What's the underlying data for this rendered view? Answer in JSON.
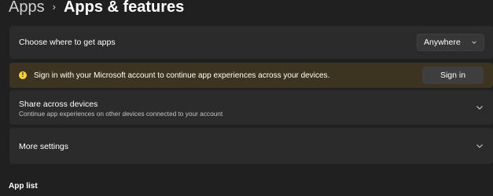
{
  "breadcrumb": {
    "parent": "Apps",
    "separator": "›",
    "current": "Apps & features"
  },
  "apps_source": {
    "label": "Choose where to get apps",
    "selected": "Anywhere"
  },
  "signin_banner": {
    "icon": "info-icon",
    "icon_glyph": "!",
    "message": "Sign in with your Microsoft account to continue app experiences across your devices.",
    "button": "Sign in"
  },
  "share": {
    "title": "Share across devices",
    "subtitle": "Continue app experiences on other devices connected to your account"
  },
  "more_settings": {
    "title": "More settings"
  },
  "app_list": {
    "heading": "App list"
  },
  "colors": {
    "background": "#202020",
    "card": "#2b2b2b",
    "banner": "#3c3420",
    "warning_icon": "#f8d33b"
  }
}
